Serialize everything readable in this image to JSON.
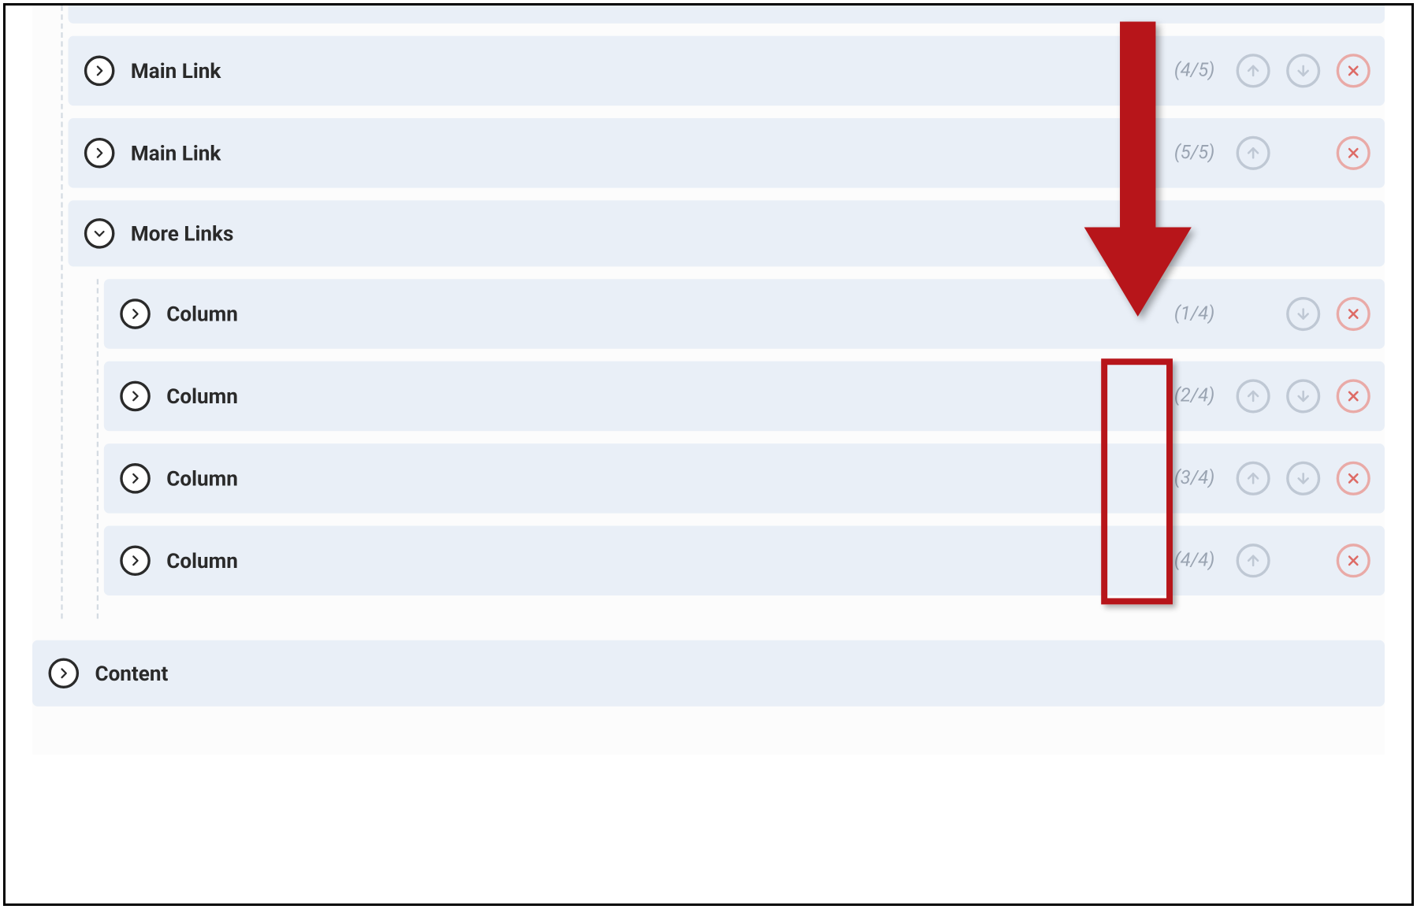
{
  "rows": {
    "mainLink4": {
      "label": "Main Link",
      "counter": "(4/5)"
    },
    "mainLink5": {
      "label": "Main Link",
      "counter": "(5/5)"
    },
    "moreLinks": {
      "label": "More Links"
    },
    "column1": {
      "label": "Column",
      "counter": "(1/4)"
    },
    "column2": {
      "label": "Column",
      "counter": "(2/4)"
    },
    "column3": {
      "label": "Column",
      "counter": "(3/4)"
    },
    "column4": {
      "label": "Column",
      "counter": "(4/4)"
    },
    "content": {
      "label": "Content"
    }
  },
  "colors": {
    "annotation": "#b7151a"
  }
}
